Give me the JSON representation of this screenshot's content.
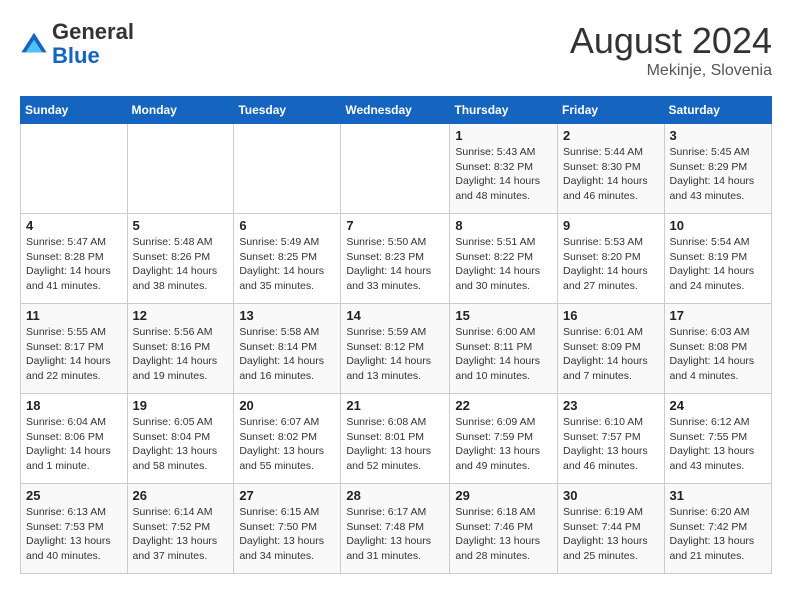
{
  "header": {
    "logo_general": "General",
    "logo_blue": "Blue",
    "month_year": "August 2024",
    "location": "Mekinje, Slovenia"
  },
  "weekdays": [
    "Sunday",
    "Monday",
    "Tuesday",
    "Wednesday",
    "Thursday",
    "Friday",
    "Saturday"
  ],
  "weeks": [
    [
      {
        "day": "",
        "info": ""
      },
      {
        "day": "",
        "info": ""
      },
      {
        "day": "",
        "info": ""
      },
      {
        "day": "",
        "info": ""
      },
      {
        "day": "1",
        "info": "Sunrise: 5:43 AM\nSunset: 8:32 PM\nDaylight: 14 hours\nand 48 minutes."
      },
      {
        "day": "2",
        "info": "Sunrise: 5:44 AM\nSunset: 8:30 PM\nDaylight: 14 hours\nand 46 minutes."
      },
      {
        "day": "3",
        "info": "Sunrise: 5:45 AM\nSunset: 8:29 PM\nDaylight: 14 hours\nand 43 minutes."
      }
    ],
    [
      {
        "day": "4",
        "info": "Sunrise: 5:47 AM\nSunset: 8:28 PM\nDaylight: 14 hours\nand 41 minutes."
      },
      {
        "day": "5",
        "info": "Sunrise: 5:48 AM\nSunset: 8:26 PM\nDaylight: 14 hours\nand 38 minutes."
      },
      {
        "day": "6",
        "info": "Sunrise: 5:49 AM\nSunset: 8:25 PM\nDaylight: 14 hours\nand 35 minutes."
      },
      {
        "day": "7",
        "info": "Sunrise: 5:50 AM\nSunset: 8:23 PM\nDaylight: 14 hours\nand 33 minutes."
      },
      {
        "day": "8",
        "info": "Sunrise: 5:51 AM\nSunset: 8:22 PM\nDaylight: 14 hours\nand 30 minutes."
      },
      {
        "day": "9",
        "info": "Sunrise: 5:53 AM\nSunset: 8:20 PM\nDaylight: 14 hours\nand 27 minutes."
      },
      {
        "day": "10",
        "info": "Sunrise: 5:54 AM\nSunset: 8:19 PM\nDaylight: 14 hours\nand 24 minutes."
      }
    ],
    [
      {
        "day": "11",
        "info": "Sunrise: 5:55 AM\nSunset: 8:17 PM\nDaylight: 14 hours\nand 22 minutes."
      },
      {
        "day": "12",
        "info": "Sunrise: 5:56 AM\nSunset: 8:16 PM\nDaylight: 14 hours\nand 19 minutes."
      },
      {
        "day": "13",
        "info": "Sunrise: 5:58 AM\nSunset: 8:14 PM\nDaylight: 14 hours\nand 16 minutes."
      },
      {
        "day": "14",
        "info": "Sunrise: 5:59 AM\nSunset: 8:12 PM\nDaylight: 14 hours\nand 13 minutes."
      },
      {
        "day": "15",
        "info": "Sunrise: 6:00 AM\nSunset: 8:11 PM\nDaylight: 14 hours\nand 10 minutes."
      },
      {
        "day": "16",
        "info": "Sunrise: 6:01 AM\nSunset: 8:09 PM\nDaylight: 14 hours\nand 7 minutes."
      },
      {
        "day": "17",
        "info": "Sunrise: 6:03 AM\nSunset: 8:08 PM\nDaylight: 14 hours\nand 4 minutes."
      }
    ],
    [
      {
        "day": "18",
        "info": "Sunrise: 6:04 AM\nSunset: 8:06 PM\nDaylight: 14 hours\nand 1 minute."
      },
      {
        "day": "19",
        "info": "Sunrise: 6:05 AM\nSunset: 8:04 PM\nDaylight: 13 hours\nand 58 minutes."
      },
      {
        "day": "20",
        "info": "Sunrise: 6:07 AM\nSunset: 8:02 PM\nDaylight: 13 hours\nand 55 minutes."
      },
      {
        "day": "21",
        "info": "Sunrise: 6:08 AM\nSunset: 8:01 PM\nDaylight: 13 hours\nand 52 minutes."
      },
      {
        "day": "22",
        "info": "Sunrise: 6:09 AM\nSunset: 7:59 PM\nDaylight: 13 hours\nand 49 minutes."
      },
      {
        "day": "23",
        "info": "Sunrise: 6:10 AM\nSunset: 7:57 PM\nDaylight: 13 hours\nand 46 minutes."
      },
      {
        "day": "24",
        "info": "Sunrise: 6:12 AM\nSunset: 7:55 PM\nDaylight: 13 hours\nand 43 minutes."
      }
    ],
    [
      {
        "day": "25",
        "info": "Sunrise: 6:13 AM\nSunset: 7:53 PM\nDaylight: 13 hours\nand 40 minutes."
      },
      {
        "day": "26",
        "info": "Sunrise: 6:14 AM\nSunset: 7:52 PM\nDaylight: 13 hours\nand 37 minutes."
      },
      {
        "day": "27",
        "info": "Sunrise: 6:15 AM\nSunset: 7:50 PM\nDaylight: 13 hours\nand 34 minutes."
      },
      {
        "day": "28",
        "info": "Sunrise: 6:17 AM\nSunset: 7:48 PM\nDaylight: 13 hours\nand 31 minutes."
      },
      {
        "day": "29",
        "info": "Sunrise: 6:18 AM\nSunset: 7:46 PM\nDaylight: 13 hours\nand 28 minutes."
      },
      {
        "day": "30",
        "info": "Sunrise: 6:19 AM\nSunset: 7:44 PM\nDaylight: 13 hours\nand 25 minutes."
      },
      {
        "day": "31",
        "info": "Sunrise: 6:20 AM\nSunset: 7:42 PM\nDaylight: 13 hours\nand 21 minutes."
      }
    ]
  ]
}
